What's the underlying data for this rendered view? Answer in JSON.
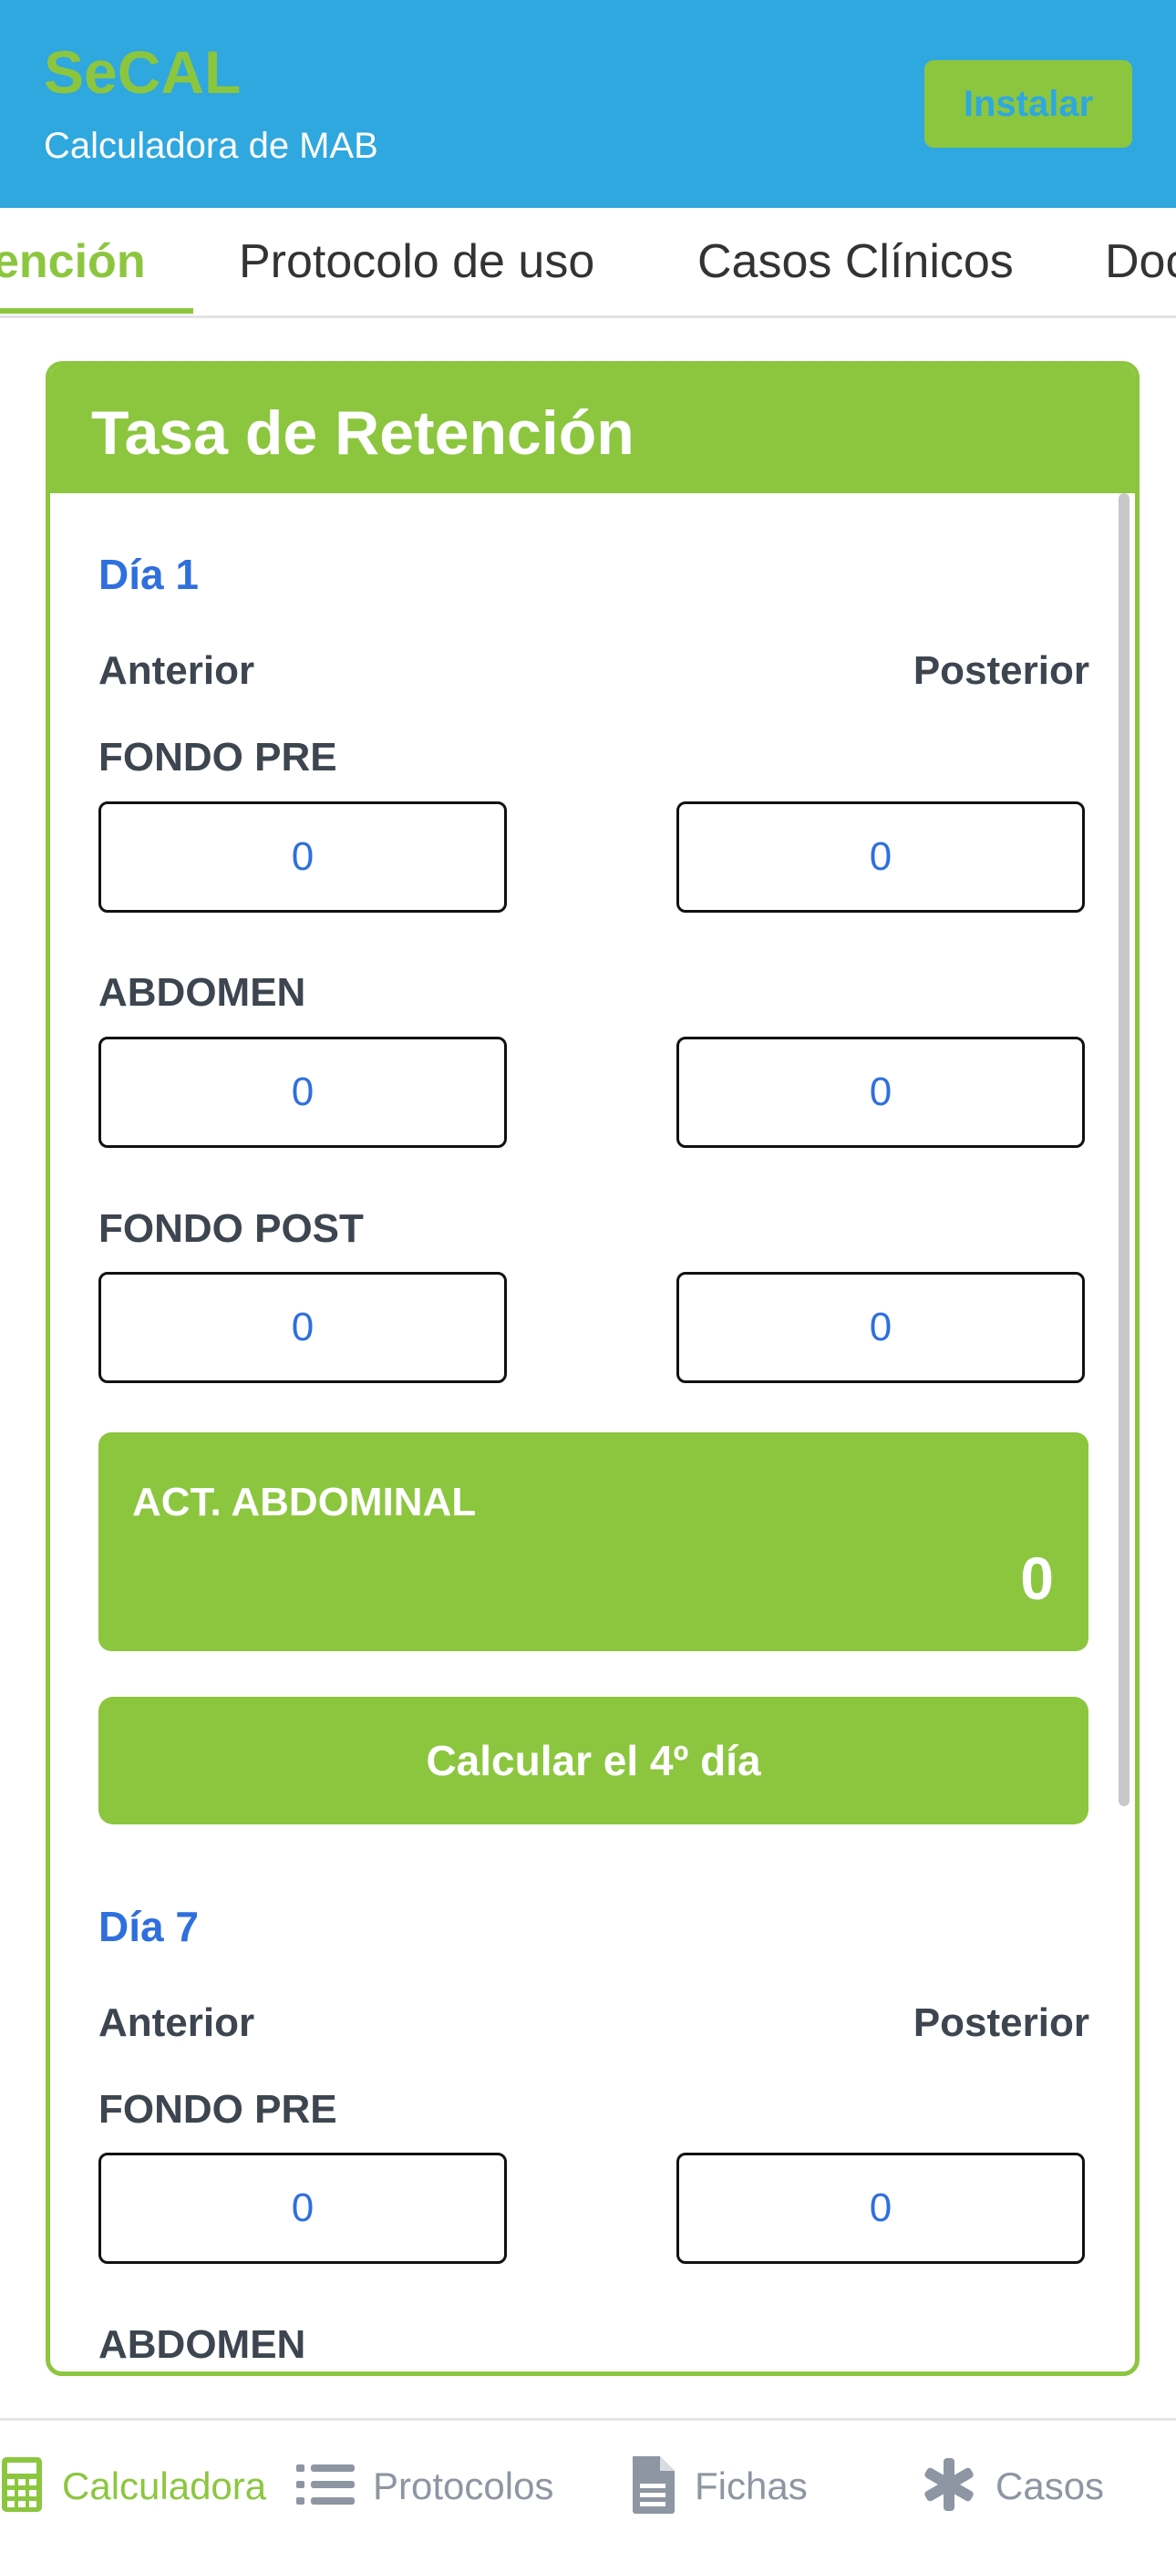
{
  "header": {
    "app_title": "SeCAL",
    "app_subtitle": "Calculadora de MAB",
    "install_label": "Instalar"
  },
  "tabs": [
    {
      "label": "ención",
      "active": true
    },
    {
      "label": "Protocolo de uso",
      "active": false
    },
    {
      "label": "Casos Clínicos",
      "active": false
    },
    {
      "label": "Doc",
      "active": false
    }
  ],
  "card": {
    "title": "Tasa de Retención",
    "day1": {
      "label": "Día 1",
      "anterior": "Anterior",
      "posterior": "Posterior",
      "fields": [
        {
          "label": "FONDO PRE",
          "anterior": "0",
          "posterior": "0"
        },
        {
          "label": "ABDOMEN",
          "anterior": "0",
          "posterior": "0"
        },
        {
          "label": "FONDO POST",
          "anterior": "0",
          "posterior": "0"
        }
      ],
      "result_label": "ACT. ABDOMINAL",
      "result_value": "0",
      "calc_button": "Calcular el 4º día"
    },
    "day7": {
      "label": "Día 7",
      "anterior": "Anterior",
      "posterior": "Posterior",
      "fields": [
        {
          "label": "FONDO PRE",
          "anterior": "0",
          "posterior": "0"
        },
        {
          "label": "ABDOMEN"
        }
      ]
    }
  },
  "bottom_nav": [
    {
      "label": "Calculadora",
      "icon": "calculator-icon",
      "active": true
    },
    {
      "label": "Protocolos",
      "icon": "list-icon",
      "active": false
    },
    {
      "label": "Fichas",
      "icon": "document-icon",
      "active": false
    },
    {
      "label": "Casos",
      "icon": "asterisk-icon",
      "active": false
    }
  ],
  "colors": {
    "header_bg": "#2fa7df",
    "accent_green": "#8cc63f",
    "link_blue": "#2f6fde",
    "nav_gray": "#8e95a3"
  }
}
